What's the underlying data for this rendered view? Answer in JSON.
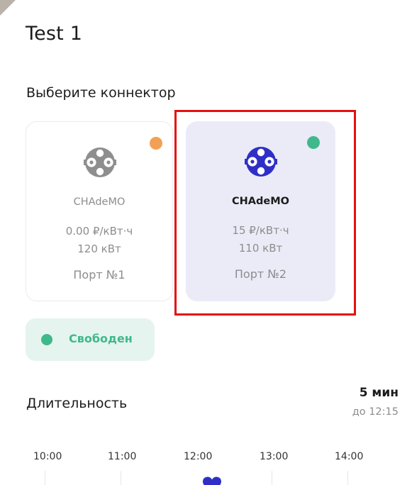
{
  "screen": {
    "title": "Test 1",
    "section_title": "Выберите коннектор"
  },
  "connectors": [
    {
      "type": "CHAdeMO",
      "price": "0.00 ₽/кВт·ч",
      "power": "120 кВт",
      "port": "Порт №1",
      "status_color": "#f2a055",
      "icon": "chademo-plug-icon",
      "icon_color": "#8e8e8e",
      "selected": false
    },
    {
      "type": "CHAdeMO",
      "price": "15 ₽/кВт·ч",
      "power": "110 кВт",
      "port": "Порт №2",
      "status_color": "#3fb98c",
      "icon": "chademo-plug-icon",
      "icon_color": "#2f2fc6",
      "selected": true
    }
  ],
  "status": {
    "label": "Свободен",
    "color": "#3fb98c"
  },
  "duration": {
    "label": "Длительность",
    "value": "5 мин",
    "until": "до 12:15"
  },
  "timeline": {
    "ticks": [
      "10:00",
      "11:00",
      "12:00",
      "13:00",
      "14:00"
    ],
    "handle_color": "#2f2fc6"
  },
  "colors": {
    "accent": "#2f2fc6",
    "highlight": "#e31010",
    "selected_card_bg": "#ebebf8"
  }
}
